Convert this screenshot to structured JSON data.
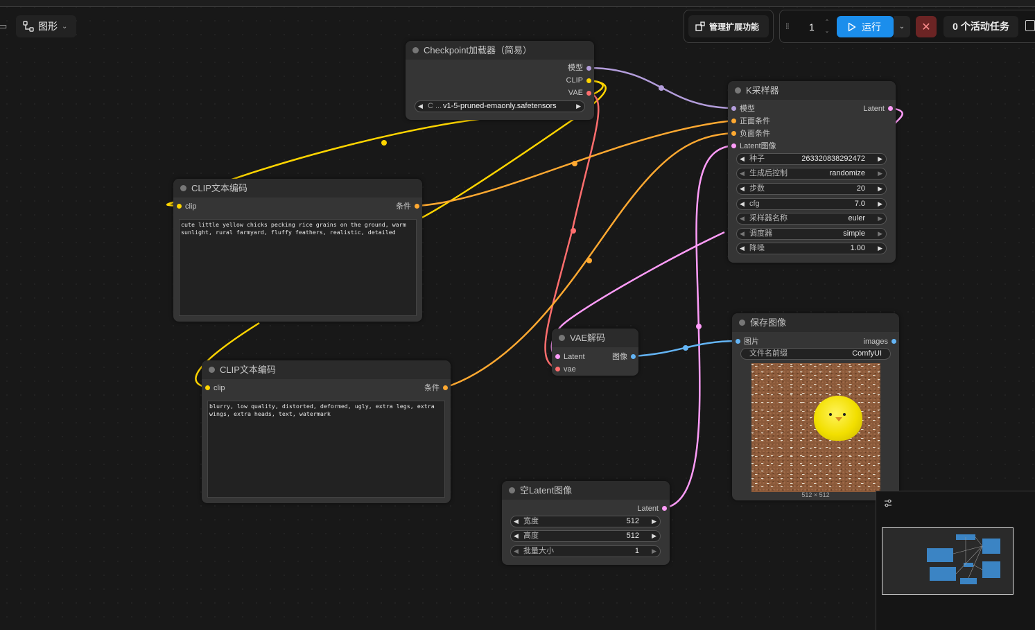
{
  "topbar": {
    "graph_tab": "图形",
    "manage_extensions": "管理扩展功能",
    "queue_count": "1",
    "run_label": "运行",
    "active_tasks": "0 个活动任务"
  },
  "nodes": {
    "checkpoint": {
      "title": "Checkpoint加载器（简易）",
      "outputs": [
        "模型",
        "CLIP",
        "VAE"
      ],
      "ckpt_prefix": "C ...",
      "ckpt_name": "v1-5-pruned-emaonly.safetensors"
    },
    "clip_positive": {
      "title": "CLIP文本编码",
      "input": "clip",
      "output": "条件",
      "text": "cute little yellow chicks pecking rice grains on the ground, warm sunlight, rural farmyard, fluffy feathers, realistic, detailed"
    },
    "clip_negative": {
      "title": "CLIP文本编码",
      "input": "clip",
      "output": "条件",
      "text": "blurry, low quality, distorted, deformed, ugly, extra legs, extra wings, extra heads, text, watermark"
    },
    "ksampler": {
      "title": "K采样器",
      "inputs": [
        "模型",
        "正面条件",
        "负面条件",
        "Latent图像"
      ],
      "output": "Latent",
      "widgets": [
        {
          "label": "种子",
          "value": "263320838292472"
        },
        {
          "label": "生成后控制",
          "value": "randomize"
        },
        {
          "label": "步数",
          "value": "20"
        },
        {
          "label": "cfg",
          "value": "7.0"
        },
        {
          "label": "采样器名称",
          "value": "euler"
        },
        {
          "label": "调度器",
          "value": "simple"
        },
        {
          "label": "降噪",
          "value": "1.00"
        }
      ]
    },
    "vae_decode": {
      "title": "VAE解码",
      "inputs": [
        "Latent",
        "vae"
      ],
      "output": "图像"
    },
    "save_image": {
      "title": "保存图像",
      "input": "图片",
      "output": "images",
      "prefix_label": "文件名前缀",
      "prefix_value": "ComfyUI",
      "image_size": "512 × 512"
    },
    "empty_latent": {
      "title": "空Latent图像",
      "output": "Latent",
      "widgets": [
        {
          "label": "宽度",
          "value": "512"
        },
        {
          "label": "高度",
          "value": "512"
        },
        {
          "label": "批量大小",
          "value": "1"
        }
      ]
    }
  },
  "colors": {
    "model": "#b39ddb",
    "clip": "#ffd500",
    "vae": "#ff6e6e",
    "conditioning": "#ffa931",
    "latent": "#ff9cf9",
    "image": "#64b5f6",
    "run": "#1b8eec"
  }
}
